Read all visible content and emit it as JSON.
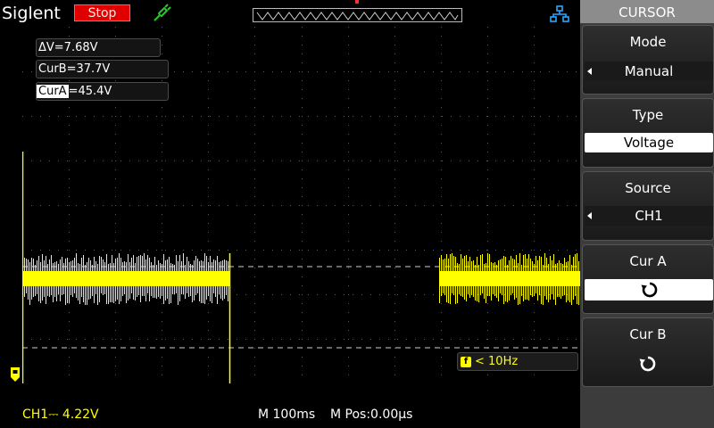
{
  "header": {
    "brand": "Siglent",
    "run_state": "Stop"
  },
  "measurements": {
    "delta": "ΔV=7.68V",
    "cur_b": "CurB=37.7V",
    "cur_a_tag": "CurA",
    "cur_a_value": "=45.4V"
  },
  "trigger": {
    "icon": "f",
    "frequency": "< 10Hz"
  },
  "status_bar": {
    "ch1_scale": "CH1⎓ 4.22V",
    "timebase": "M 100ms",
    "position": "M Pos:0.00µs"
  },
  "menu": {
    "title": "CURSOR",
    "mode_label": "Mode",
    "mode_value": "Manual",
    "type_label": "Type",
    "type_value": "Voltage",
    "source_label": "Source",
    "source_value": "CH1",
    "cur_a_label": "Cur A",
    "cur_b_label": "Cur B"
  },
  "colors": {
    "ch1": "#ffff00",
    "stop": "#e00000",
    "menu_bg": "#3c3c3c",
    "accent_icon": "#2aa8ff",
    "probe_icon": "#22cc22"
  },
  "icons": {
    "probe": "probe-icon",
    "network": "network-icon",
    "knob": "rotary-knob-icon"
  }
}
